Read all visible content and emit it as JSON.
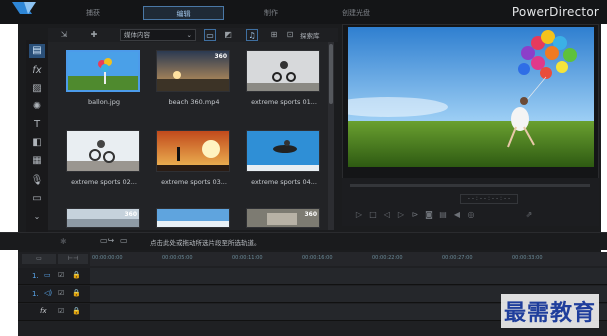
{
  "app": {
    "brand": "PowerDirector"
  },
  "mode_tabs": [
    {
      "label": "捕获",
      "active": false
    },
    {
      "label": "编辑",
      "active": true
    },
    {
      "label": "制作",
      "active": false
    },
    {
      "label": "创建光盘",
      "active": false
    }
  ],
  "library": {
    "filter_dropdown": "媒体内容",
    "explore_button": "探索库",
    "clips": [
      {
        "label": "ballon.jpg",
        "badge": ""
      },
      {
        "label": "beach 360.mp4",
        "badge": "360"
      },
      {
        "label": "extreme sports 01...",
        "badge": ""
      },
      {
        "label": "extreme sports 02...",
        "badge": ""
      },
      {
        "label": "extreme sports 03...",
        "badge": ""
      },
      {
        "label": "extreme sports 04...",
        "badge": ""
      },
      {
        "label": "",
        "badge": "360"
      },
      {
        "label": "",
        "badge": ""
      },
      {
        "label": "",
        "badge": "360"
      }
    ]
  },
  "preview": {
    "timecode": "- - : - - : - - : - -"
  },
  "toolbar_hint": "点击此处或拖动所选片段至所选轨道。",
  "timeline": {
    "ticks": [
      "00:00:00:00",
      "00:00:05:00",
      "00:00:11:00",
      "00:00:16:00",
      "00:00:22:00",
      "00:00:27:00",
      "00:00:33:00"
    ],
    "tracks": [
      {
        "label": "1.",
        "icon": "video-icon"
      },
      {
        "label": "1.",
        "icon": "audio-icon"
      },
      {
        "label": "fx",
        "icon": "effects-icon"
      }
    ]
  },
  "watermark": "最需教育",
  "colors": {
    "accent": "#4c9bea",
    "active_tab": "#2a4f78",
    "watermark": "#1f3e9c"
  }
}
